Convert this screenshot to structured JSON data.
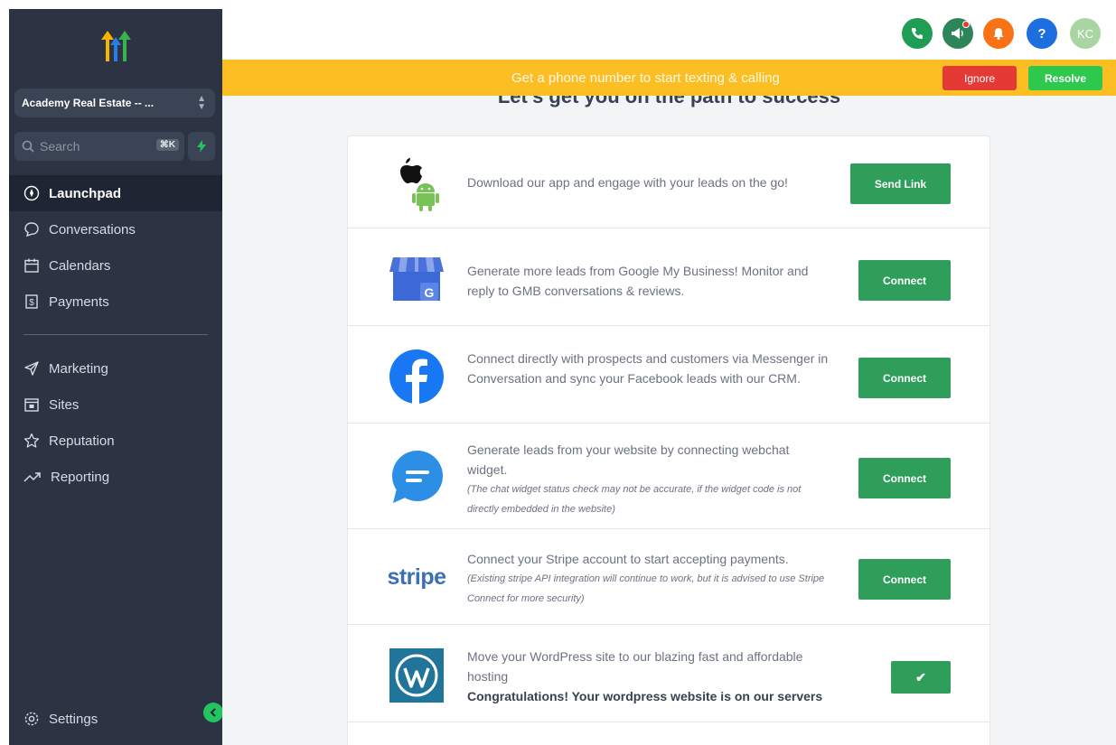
{
  "sidebar": {
    "account_name": "Academy Real Estate -- ...",
    "search_placeholder": "Search",
    "search_shortcut": "⌘K",
    "nav_primary": [
      {
        "label": "Launchpad",
        "icon": "rocket-icon",
        "active": true
      },
      {
        "label": "Conversations",
        "icon": "chat-bubble-icon"
      },
      {
        "label": "Calendars",
        "icon": "calendar-icon"
      },
      {
        "label": "Payments",
        "icon": "dollar-doc-icon"
      }
    ],
    "nav_secondary": [
      {
        "label": "Marketing",
        "icon": "send-icon"
      },
      {
        "label": "Sites",
        "icon": "browser-icon"
      },
      {
        "label": "Reputation",
        "icon": "star-icon"
      },
      {
        "label": "Reporting",
        "icon": "trend-icon"
      }
    ],
    "settings_label": "Settings"
  },
  "topbar": {
    "icons": [
      "phone-icon",
      "megaphone-icon",
      "bell-icon",
      "help-icon",
      "avatar"
    ],
    "avatar_initials": "KC",
    "help_glyph": "?"
  },
  "banner": {
    "text": "Get a phone number to start texting & calling",
    "ignore_label": "Ignore",
    "resolve_label": "Resolve",
    "color": "#fbbf24"
  },
  "main": {
    "heading": "Let's get you on the path to success",
    "rows": [
      {
        "icon": "apple-android-icon",
        "text": "Download our app and engage with your leads on the go!",
        "action": "Send Link"
      },
      {
        "icon": "google-my-business-icon",
        "text": "Generate more leads from Google My Business! Monitor and reply to GMB conversations & reviews.",
        "action": "Connect"
      },
      {
        "icon": "facebook-icon",
        "text": "Connect directly with prospects and customers via Messenger in Conversation and sync your Facebook leads with our CRM.",
        "action": "Connect"
      },
      {
        "icon": "webchat-icon",
        "text": "Generate leads from your website by connecting webchat widget.",
        "note": "(The chat widget status check may not be accurate, if the widget code is not directly embedded in the website)",
        "action": "Connect"
      },
      {
        "icon": "stripe-icon",
        "logo_text": "stripe",
        "text": "Connect your Stripe account to start accepting payments.",
        "note": "(Existing stripe API integration will continue to work, but it is advised to use Stripe Connect for more security)",
        "action": "Connect"
      },
      {
        "icon": "wordpress-icon",
        "text": "Move your WordPress site to our blazing fast and affordable hosting",
        "strong": "Congratulations! Your wordpress website is on our servers",
        "action": "✔"
      }
    ]
  },
  "colors": {
    "sidebar": "#2c3444",
    "accent_green": "#2f9e5b",
    "danger": "#e53935"
  }
}
